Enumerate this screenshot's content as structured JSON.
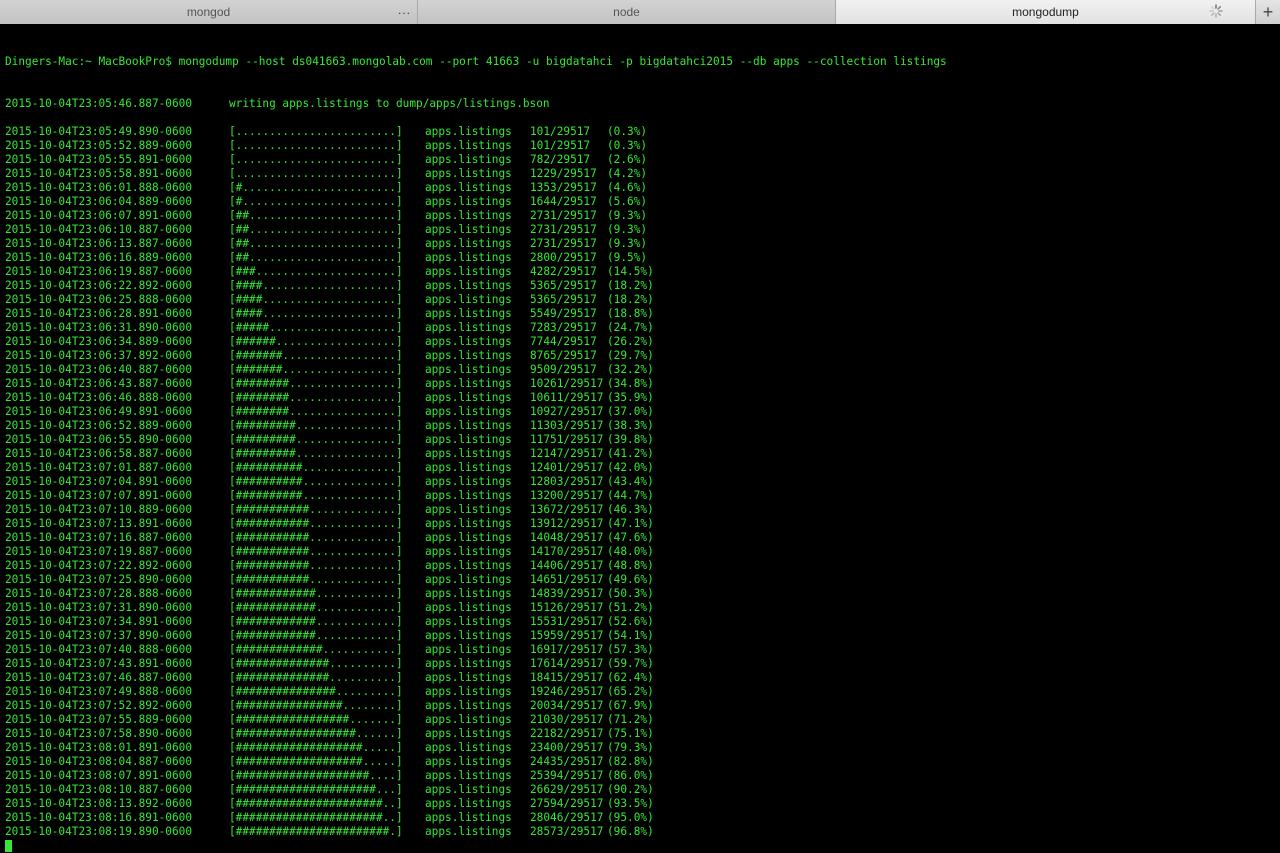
{
  "tabs": [
    {
      "label": "mongod",
      "active": false
    },
    {
      "label": "node",
      "active": false
    },
    {
      "label": "mongodump",
      "active": true
    }
  ],
  "tab_menu_icon": "ellipsis-icon",
  "tab_busy_icon": "spinner-icon",
  "new_tab_icon": "plus-icon",
  "new_tab_label": "+",
  "ellipsis": "...",
  "text_color": "#35e835",
  "background_color": "#000000",
  "command_line": "Dingers-Mac:~ MacBookPro$ mongodump --host ds041663.mongolab.com --port 41663 -u bigdatahci -p bigdatahci2015 --db apps --collection listings",
  "writing_line": {
    "ts": "2015-10-04T23:05:46.887-0600",
    "msg": "writing apps.listings to dump/apps/listings.bson"
  },
  "progress": [
    {
      "ts": "2015-10-04T23:05:49.890-0600",
      "bar": "[........................]",
      "ns": "apps.listings",
      "count": "101/29517",
      "pct": "(0.3%)"
    },
    {
      "ts": "2015-10-04T23:05:52.889-0600",
      "bar": "[........................]",
      "ns": "apps.listings",
      "count": "101/29517",
      "pct": "(0.3%)"
    },
    {
      "ts": "2015-10-04T23:05:55.891-0600",
      "bar": "[........................]",
      "ns": "apps.listings",
      "count": "782/29517",
      "pct": "(2.6%)"
    },
    {
      "ts": "2015-10-04T23:05:58.891-0600",
      "bar": "[........................]",
      "ns": "apps.listings",
      "count": "1229/29517",
      "pct": "(4.2%)"
    },
    {
      "ts": "2015-10-04T23:06:01.888-0600",
      "bar": "[#.......................]",
      "ns": "apps.listings",
      "count": "1353/29517",
      "pct": "(4.6%)"
    },
    {
      "ts": "2015-10-04T23:06:04.889-0600",
      "bar": "[#.......................]",
      "ns": "apps.listings",
      "count": "1644/29517",
      "pct": "(5.6%)"
    },
    {
      "ts": "2015-10-04T23:06:07.891-0600",
      "bar": "[##......................]",
      "ns": "apps.listings",
      "count": "2731/29517",
      "pct": "(9.3%)"
    },
    {
      "ts": "2015-10-04T23:06:10.887-0600",
      "bar": "[##......................]",
      "ns": "apps.listings",
      "count": "2731/29517",
      "pct": "(9.3%)"
    },
    {
      "ts": "2015-10-04T23:06:13.887-0600",
      "bar": "[##......................]",
      "ns": "apps.listings",
      "count": "2731/29517",
      "pct": "(9.3%)"
    },
    {
      "ts": "2015-10-04T23:06:16.889-0600",
      "bar": "[##......................]",
      "ns": "apps.listings",
      "count": "2800/29517",
      "pct": "(9.5%)"
    },
    {
      "ts": "2015-10-04T23:06:19.887-0600",
      "bar": "[###.....................]",
      "ns": "apps.listings",
      "count": "4282/29517",
      "pct": "(14.5%)"
    },
    {
      "ts": "2015-10-04T23:06:22.892-0600",
      "bar": "[####....................]",
      "ns": "apps.listings",
      "count": "5365/29517",
      "pct": "(18.2%)"
    },
    {
      "ts": "2015-10-04T23:06:25.888-0600",
      "bar": "[####....................]",
      "ns": "apps.listings",
      "count": "5365/29517",
      "pct": "(18.2%)"
    },
    {
      "ts": "2015-10-04T23:06:28.891-0600",
      "bar": "[####....................]",
      "ns": "apps.listings",
      "count": "5549/29517",
      "pct": "(18.8%)"
    },
    {
      "ts": "2015-10-04T23:06:31.890-0600",
      "bar": "[#####...................]",
      "ns": "apps.listings",
      "count": "7283/29517",
      "pct": "(24.7%)"
    },
    {
      "ts": "2015-10-04T23:06:34.889-0600",
      "bar": "[######..................]",
      "ns": "apps.listings",
      "count": "7744/29517",
      "pct": "(26.2%)"
    },
    {
      "ts": "2015-10-04T23:06:37.892-0600",
      "bar": "[#######.................]",
      "ns": "apps.listings",
      "count": "8765/29517",
      "pct": "(29.7%)"
    },
    {
      "ts": "2015-10-04T23:06:40.887-0600",
      "bar": "[#######.................]",
      "ns": "apps.listings",
      "count": "9509/29517",
      "pct": "(32.2%)"
    },
    {
      "ts": "2015-10-04T23:06:43.887-0600",
      "bar": "[########................]",
      "ns": "apps.listings",
      "count": "10261/29517",
      "pct": "(34.8%)"
    },
    {
      "ts": "2015-10-04T23:06:46.888-0600",
      "bar": "[########................]",
      "ns": "apps.listings",
      "count": "10611/29517",
      "pct": "(35.9%)"
    },
    {
      "ts": "2015-10-04T23:06:49.891-0600",
      "bar": "[########................]",
      "ns": "apps.listings",
      "count": "10927/29517",
      "pct": "(37.0%)"
    },
    {
      "ts": "2015-10-04T23:06:52.889-0600",
      "bar": "[#########...............]",
      "ns": "apps.listings",
      "count": "11303/29517",
      "pct": "(38.3%)"
    },
    {
      "ts": "2015-10-04T23:06:55.890-0600",
      "bar": "[#########...............]",
      "ns": "apps.listings",
      "count": "11751/29517",
      "pct": "(39.8%)"
    },
    {
      "ts": "2015-10-04T23:06:58.887-0600",
      "bar": "[#########...............]",
      "ns": "apps.listings",
      "count": "12147/29517",
      "pct": "(41.2%)"
    },
    {
      "ts": "2015-10-04T23:07:01.887-0600",
      "bar": "[##########..............]",
      "ns": "apps.listings",
      "count": "12401/29517",
      "pct": "(42.0%)"
    },
    {
      "ts": "2015-10-04T23:07:04.891-0600",
      "bar": "[##########..............]",
      "ns": "apps.listings",
      "count": "12803/29517",
      "pct": "(43.4%)"
    },
    {
      "ts": "2015-10-04T23:07:07.891-0600",
      "bar": "[##########..............]",
      "ns": "apps.listings",
      "count": "13200/29517",
      "pct": "(44.7%)"
    },
    {
      "ts": "2015-10-04T23:07:10.889-0600",
      "bar": "[###########.............]",
      "ns": "apps.listings",
      "count": "13672/29517",
      "pct": "(46.3%)"
    },
    {
      "ts": "2015-10-04T23:07:13.891-0600",
      "bar": "[###########.............]",
      "ns": "apps.listings",
      "count": "13912/29517",
      "pct": "(47.1%)"
    },
    {
      "ts": "2015-10-04T23:07:16.887-0600",
      "bar": "[###########.............]",
      "ns": "apps.listings",
      "count": "14048/29517",
      "pct": "(47.6%)"
    },
    {
      "ts": "2015-10-04T23:07:19.887-0600",
      "bar": "[###########.............]",
      "ns": "apps.listings",
      "count": "14170/29517",
      "pct": "(48.0%)"
    },
    {
      "ts": "2015-10-04T23:07:22.892-0600",
      "bar": "[###########.............]",
      "ns": "apps.listings",
      "count": "14406/29517",
      "pct": "(48.8%)"
    },
    {
      "ts": "2015-10-04T23:07:25.890-0600",
      "bar": "[###########.............]",
      "ns": "apps.listings",
      "count": "14651/29517",
      "pct": "(49.6%)"
    },
    {
      "ts": "2015-10-04T23:07:28.888-0600",
      "bar": "[############............]",
      "ns": "apps.listings",
      "count": "14839/29517",
      "pct": "(50.3%)"
    },
    {
      "ts": "2015-10-04T23:07:31.890-0600",
      "bar": "[############............]",
      "ns": "apps.listings",
      "count": "15126/29517",
      "pct": "(51.2%)"
    },
    {
      "ts": "2015-10-04T23:07:34.891-0600",
      "bar": "[############............]",
      "ns": "apps.listings",
      "count": "15531/29517",
      "pct": "(52.6%)"
    },
    {
      "ts": "2015-10-04T23:07:37.890-0600",
      "bar": "[############............]",
      "ns": "apps.listings",
      "count": "15959/29517",
      "pct": "(54.1%)"
    },
    {
      "ts": "2015-10-04T23:07:40.888-0600",
      "bar": "[#############...........]",
      "ns": "apps.listings",
      "count": "16917/29517",
      "pct": "(57.3%)"
    },
    {
      "ts": "2015-10-04T23:07:43.891-0600",
      "bar": "[##############..........]",
      "ns": "apps.listings",
      "count": "17614/29517",
      "pct": "(59.7%)"
    },
    {
      "ts": "2015-10-04T23:07:46.887-0600",
      "bar": "[##############..........]",
      "ns": "apps.listings",
      "count": "18415/29517",
      "pct": "(62.4%)"
    },
    {
      "ts": "2015-10-04T23:07:49.888-0600",
      "bar": "[###############.........]",
      "ns": "apps.listings",
      "count": "19246/29517",
      "pct": "(65.2%)"
    },
    {
      "ts": "2015-10-04T23:07:52.892-0600",
      "bar": "[################........]",
      "ns": "apps.listings",
      "count": "20034/29517",
      "pct": "(67.9%)"
    },
    {
      "ts": "2015-10-04T23:07:55.889-0600",
      "bar": "[#################.......]",
      "ns": "apps.listings",
      "count": "21030/29517",
      "pct": "(71.2%)"
    },
    {
      "ts": "2015-10-04T23:07:58.890-0600",
      "bar": "[##################......]",
      "ns": "apps.listings",
      "count": "22182/29517",
      "pct": "(75.1%)"
    },
    {
      "ts": "2015-10-04T23:08:01.891-0600",
      "bar": "[###################.....]",
      "ns": "apps.listings",
      "count": "23400/29517",
      "pct": "(79.3%)"
    },
    {
      "ts": "2015-10-04T23:08:04.887-0600",
      "bar": "[###################.....]",
      "ns": "apps.listings",
      "count": "24435/29517",
      "pct": "(82.8%)"
    },
    {
      "ts": "2015-10-04T23:08:07.891-0600",
      "bar": "[####################....]",
      "ns": "apps.listings",
      "count": "25394/29517",
      "pct": "(86.0%)"
    },
    {
      "ts": "2015-10-04T23:08:10.887-0600",
      "bar": "[#####################...]",
      "ns": "apps.listings",
      "count": "26629/29517",
      "pct": "(90.2%)"
    },
    {
      "ts": "2015-10-04T23:08:13.892-0600",
      "bar": "[######################..]",
      "ns": "apps.listings",
      "count": "27594/29517",
      "pct": "(93.5%)"
    },
    {
      "ts": "2015-10-04T23:08:16.891-0600",
      "bar": "[######################..]",
      "ns": "apps.listings",
      "count": "28046/29517",
      "pct": "(95.0%)"
    },
    {
      "ts": "2015-10-04T23:08:19.890-0600",
      "bar": "[#######################.]",
      "ns": "apps.listings",
      "count": "28573/29517",
      "pct": "(96.8%)"
    }
  ]
}
